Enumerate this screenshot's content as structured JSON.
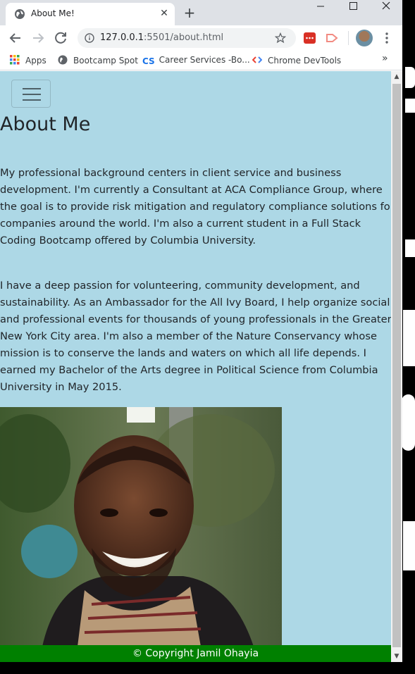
{
  "browser": {
    "tab_title": "About Me!",
    "tab_close": "✕",
    "new_tab": "+",
    "url_host": "127.0.0.1",
    "url_path": ":5501/about.html",
    "bookmarks": {
      "apps": "Apps",
      "bootcamp": "Bootcamp Spot",
      "career": "Career Services -Bo...",
      "devtools": "Chrome DevTools",
      "more": "»"
    },
    "window_controls": {
      "minimize": "—",
      "maximize": "☐",
      "close": "✕"
    }
  },
  "page": {
    "title": "About Me",
    "paragraph1": "My professional background centers in client service and business development. I'm currently a Consultant at ACA Compliance Group, where the goal is to provide risk mitigation and regulatory compliance solutions for companies around the world. I'm also a current student in a Full Stack Coding Bootcamp offered by Columbia University.",
    "paragraph2": "I have a deep passion for volunteering, community development, and sustainability. As an Ambassador for the All Ivy Board, I help organize social and professional events for thousands of young professionals in the Greater New York City area. I'm also a member of the Nature Conservancy whose mission is to conserve the lands and waters on which all life depends. I earned my Bachelor of the Arts degree in Political Science from Columbia University in May 2015.",
    "footer": "© Copyright Jamil Ohayia"
  },
  "colors": {
    "page_bg": "#add8e6",
    "footer_bg": "#008000",
    "footer_text": "#ffffff",
    "tabstrip_bg": "#dee1e6"
  },
  "icons": [
    "globe-icon",
    "close-icon",
    "plus-icon",
    "back-icon",
    "forward-icon",
    "reload-icon",
    "info-icon",
    "star-icon",
    "extension-icon",
    "profile-avatar",
    "menu-dots-icon",
    "apps-grid-icon",
    "hamburger-icon"
  ]
}
